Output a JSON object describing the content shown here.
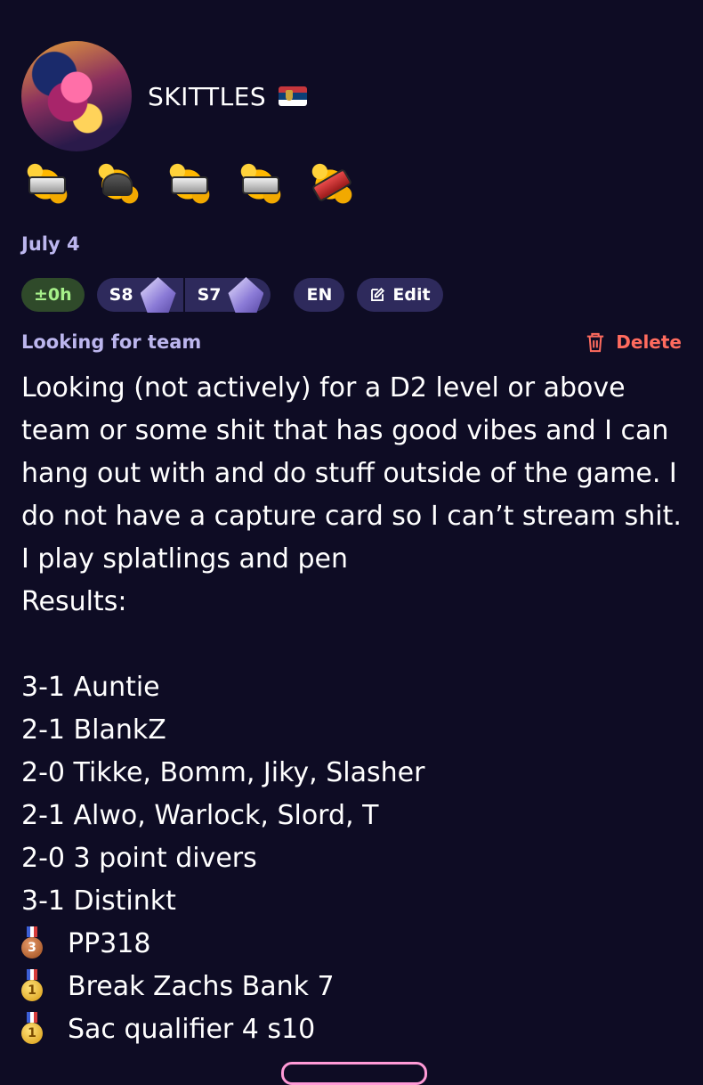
{
  "profile": {
    "name": "SKITTLES",
    "flag": "Serbia",
    "date": "July 4"
  },
  "weapons": [
    "weapon-1",
    "weapon-2",
    "weapon-3",
    "weapon-4",
    "weapon-5"
  ],
  "pills": {
    "timezone": "±0h",
    "season_a": "S8",
    "season_b": "S7",
    "language": "EN",
    "edit": "Edit"
  },
  "post": {
    "title": "Looking for team",
    "delete_label": "Delete",
    "body": "Looking (not actively) for a D2 level or above team or some shit that has good vibes and I can hang out with and do stuff outside of the game. I do not have a capture card so I can’t stream shit. I play splatlings and pen\nResults:",
    "results": [
      "3-1 Auntie",
      "2-1 BlankZ",
      "2-0 Tikke, Bomm, Jiky, Slasher",
      "2-1 Alwo, Warlock, Slord, T",
      "2-0 3 point divers",
      "3-1 Distinkt"
    ],
    "medals": [
      {
        "place": "3",
        "type": "bronze",
        "text": "PP318"
      },
      {
        "place": "1",
        "type": "gold",
        "text": "Break Zachs Bank 7"
      },
      {
        "place": "1",
        "type": "gold",
        "text": "Sac qualifier 4 s10"
      }
    ]
  },
  "colors": {
    "background": "#0e0c24",
    "muted": "#bcb6ee",
    "danger": "#ff6b5e",
    "pill": "#2e2a5c",
    "pill_green_text": "#a6f08a"
  }
}
